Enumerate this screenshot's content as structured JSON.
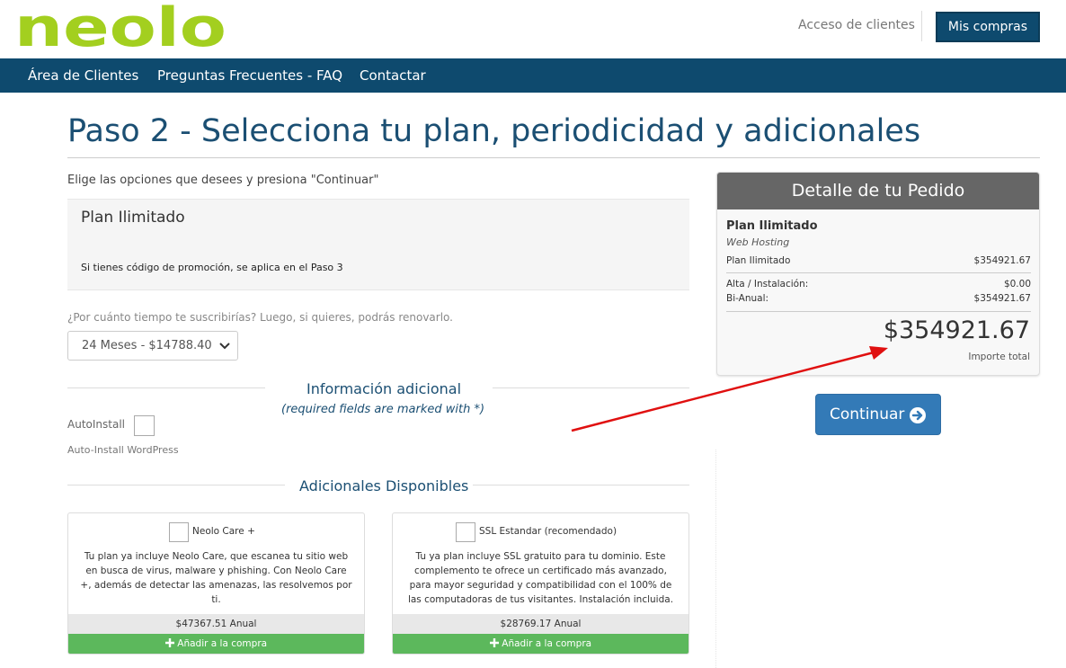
{
  "header": {
    "logo_text": "neolo",
    "acceso_label": "Acceso de clientes",
    "mis_compras_label": "Mis compras"
  },
  "nav": {
    "items": [
      {
        "label": "Área de Clientes"
      },
      {
        "label": "Preguntas Frecuentes - FAQ"
      },
      {
        "label": "Contactar"
      }
    ]
  },
  "main": {
    "title": "Paso 2 - Selecciona tu plan, periodicidad y adicionales",
    "intro": "Elige las opciones que desees y presiona \"Continuar\"",
    "plan_name": "Plan Ilimitado",
    "promo_note": "Si tienes código de promoción, se aplica en el Paso 3",
    "period_question": "¿Por cuánto tiempo te suscribirías? Luego, si quieres, podrás renovarlo.",
    "period_selected": "24 Meses - $14788.40"
  },
  "additional_info": {
    "title": "Información adicional",
    "subtitle": "(required fields are marked with *)",
    "autoinstall_label": "AutoInstall",
    "autoinstall_desc": "Auto-Install WordPress"
  },
  "addons": {
    "title": "Adicionales Disponibles",
    "items": [
      {
        "name": "Neolo Care +",
        "description": "Tu plan ya incluye Neolo Care, que escanea tu sitio web en busca de virus, malware y phishing. Con Neolo Care +, además de detectar las amenazas, las resolvemos por ti.",
        "price": "$47367.51 Anual",
        "add_label": "Añadir a la compra"
      },
      {
        "name": "SSL Estandar (recomendado)",
        "description": "Tu ya plan incluye SSL gratuito para tu dominio. Este complemento te ofrece un certificado más avanzado, para mayor seguridad y compatibilidad con el 100% de las computadoras de tus visitantes. Instalación incluida.",
        "price": "$28769.17 Anual",
        "add_label": "Añadir a la compra"
      }
    ]
  },
  "order": {
    "title": "Detalle de tu Pedido",
    "plan": "Plan Ilimitado",
    "category": "Web Hosting",
    "line_plan_label": "Plan Ilimitado",
    "line_plan_value": "$354921.67",
    "setup_label": "Alta / Instalación:",
    "setup_value": "$0.00",
    "cycle_label": "Bi-Anual:",
    "cycle_value": "$354921.67",
    "total": "$354921.67",
    "total_label": "Importe total"
  },
  "continue_label": "Continuar",
  "colors": {
    "brand_green": "#a3cf1f",
    "nav_blue": "#0e4a6e",
    "title_blue": "#1b4f73",
    "button_blue": "#337ab7",
    "add_green": "#5cb85c",
    "order_header": "#666666",
    "annotation_red": "#e01010"
  },
  "icons": {
    "continue_icon": "arrow-circle-right-icon",
    "select_chevron": "chevron-down-icon",
    "add_icon": "plus-icon"
  }
}
